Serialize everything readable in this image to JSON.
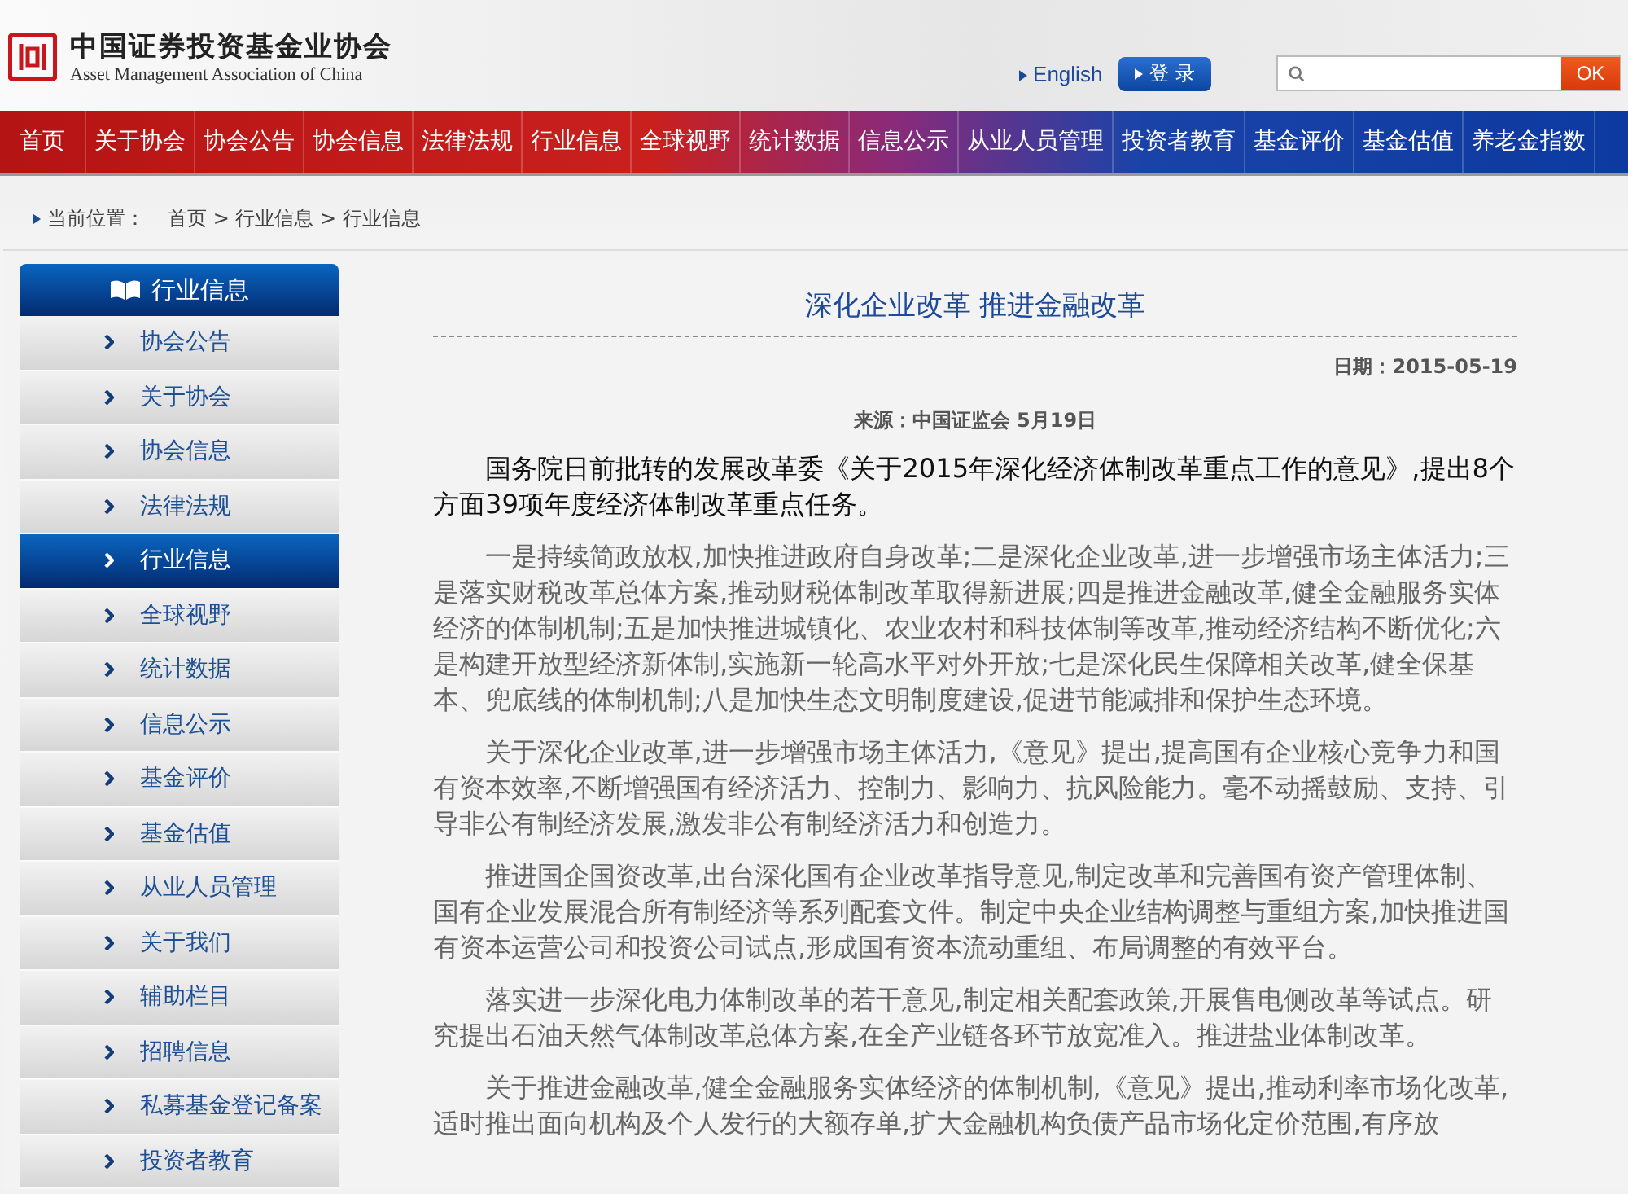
{
  "header": {
    "logo_cn": "中国证券投资基金业协会",
    "logo_en": "Asset Management Association of China",
    "english_link": "English",
    "login_button": "登 录",
    "search": {
      "button": "OK"
    }
  },
  "nav": [
    "首页",
    "关于协会",
    "协会公告",
    "协会信息",
    "法律法规",
    "行业信息",
    "全球视野",
    "统计数据",
    "信息公示",
    "从业人员管理",
    "投资者教育",
    "基金评价",
    "基金估值",
    "养老金指数"
  ],
  "breadcrumb": {
    "label": "当前位置：",
    "path": "首页 > 行业信息 > 行业信息"
  },
  "sidebar": {
    "title": "行业信息",
    "items": [
      {
        "label": "协会公告",
        "selected": false
      },
      {
        "label": "关于协会",
        "selected": false
      },
      {
        "label": "协会信息",
        "selected": false
      },
      {
        "label": "法律法规",
        "selected": false
      },
      {
        "label": "行业信息",
        "selected": true
      },
      {
        "label": "全球视野",
        "selected": false
      },
      {
        "label": "统计数据",
        "selected": false
      },
      {
        "label": "信息公示",
        "selected": false
      },
      {
        "label": "基金评价",
        "selected": false
      },
      {
        "label": "基金估值",
        "selected": false
      },
      {
        "label": "从业人员管理",
        "selected": false
      },
      {
        "label": "关于我们",
        "selected": false
      },
      {
        "label": "辅助栏目",
        "selected": false
      },
      {
        "label": "招聘信息",
        "selected": false
      },
      {
        "label": "私募基金登记备案",
        "selected": false
      },
      {
        "label": "投资者教育",
        "selected": false
      }
    ]
  },
  "article": {
    "title": "深化企业改革 推进金融改革",
    "date": "日期：2015-05-19",
    "source": "来源：中国证监会  5月19日",
    "paragraphs": [
      {
        "kind": "lead",
        "text": "国务院日前批转的发展改革委《关于2015年深化经济体制改革重点工作的意见》,提出8个方面39项年度经济体制改革重点任务。"
      },
      {
        "kind": "body",
        "text": "一是持续简政放权,加快推进政府自身改革;二是深化企业改革,进一步增强市场主体活力;三是落实财税改革总体方案,推动财税体制改革取得新进展;四是推进金融改革,健全金融服务实体经济的体制机制;五是加快推进城镇化、农业农村和科技体制等改革,推动经济结构不断优化;六是构建开放型经济新体制,实施新一轮高水平对外开放;七是深化民生保障相关改革,健全保基本、兜底线的体制机制;八是加快生态文明制度建设,促进节能减排和保护生态环境。"
      },
      {
        "kind": "body",
        "text": "关于深化企业改革,进一步增强市场主体活力,《意见》提出,提高国有企业核心竞争力和国有资本效率,不断增强国有经济活力、控制力、影响力、抗风险能力。毫不动摇鼓励、支持、引导非公有制经济发展,激发非公有制经济活力和创造力。"
      },
      {
        "kind": "body",
        "text": "推进国企国资改革,出台深化国有企业改革指导意见,制定改革和完善国有资产管理体制、国有企业发展混合所有制经济等系列配套文件。制定中央企业结构调整与重组方案,加快推进国有资本运营公司和投资公司试点,形成国有资本流动重组、布局调整的有效平台。"
      },
      {
        "kind": "body",
        "text": "落实进一步深化电力体制改革的若干意见,制定相关配套政策,开展售电侧改革等试点。研究提出石油天然气体制改革总体方案,在全产业链各环节放宽准入。推进盐业体制改革。"
      },
      {
        "kind": "body",
        "text": "关于推进金融改革,健全金融服务实体经济的体制机制,《意见》提出,推动利率市场化改革,适时推出面向机构及个人发行的大额存单,扩大金融机构负债产品市场化定价范围,有序放"
      }
    ]
  }
}
